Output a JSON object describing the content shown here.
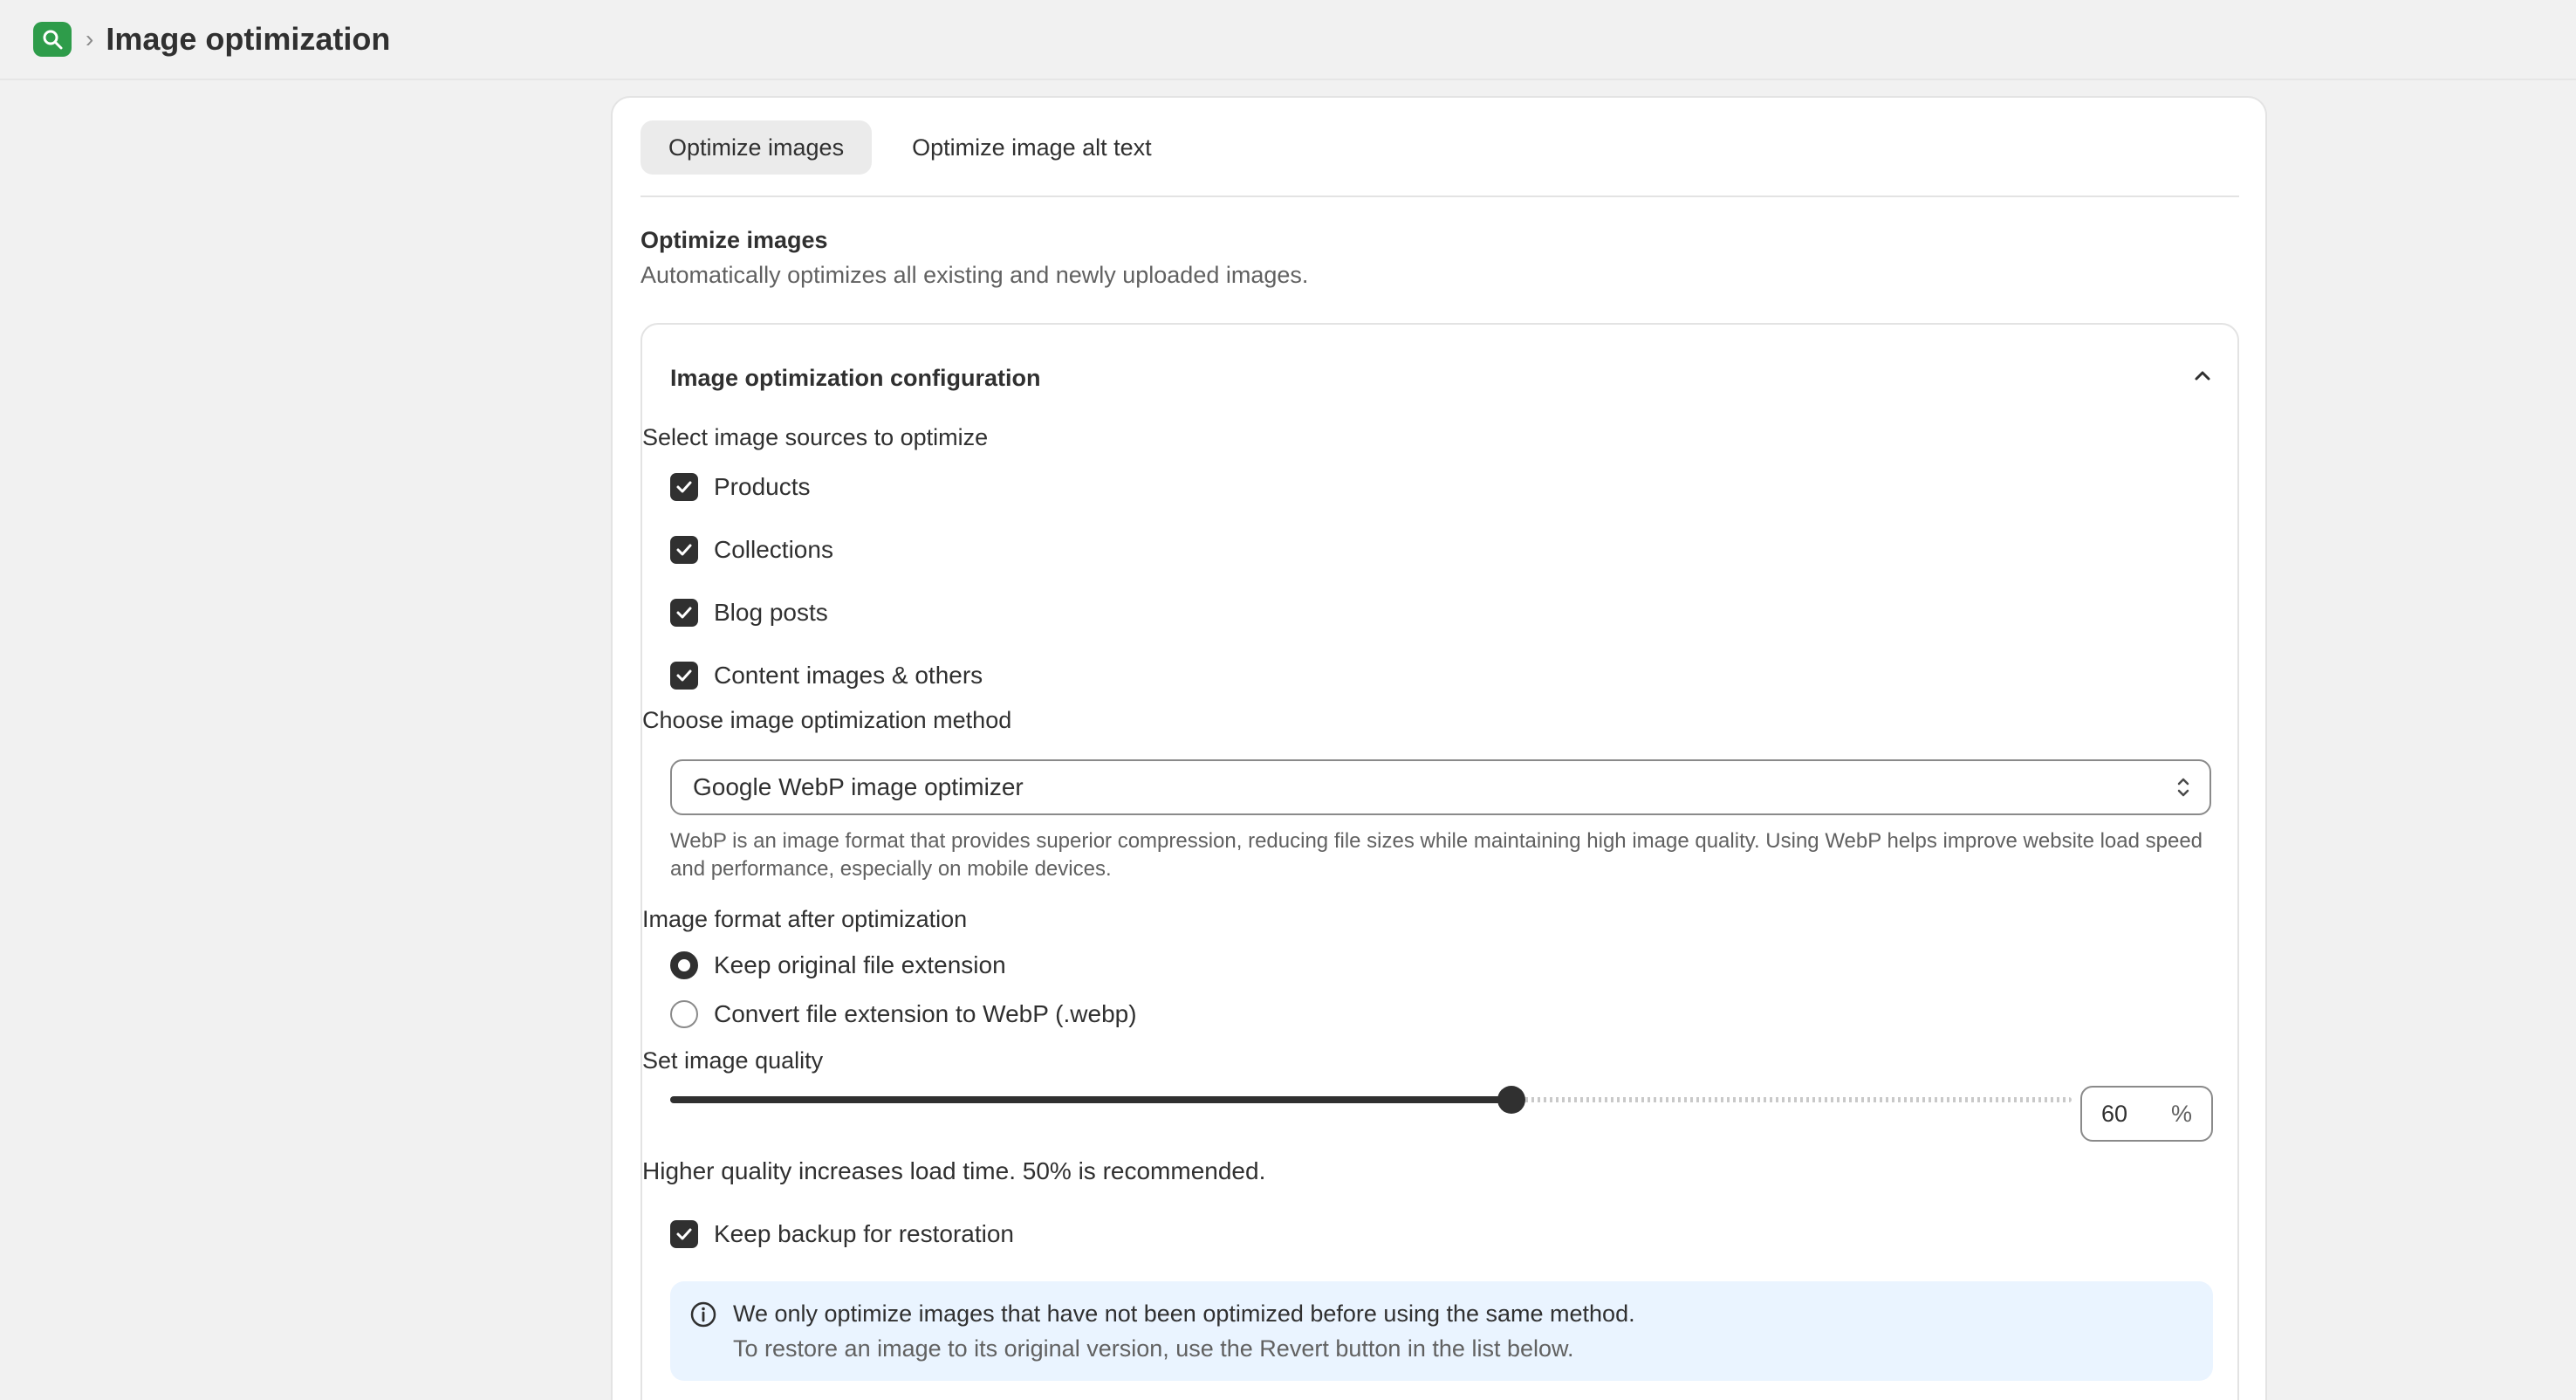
{
  "header": {
    "breadcrumb_separator": "›",
    "title": "Image optimization",
    "app_icon": "search-leaf-icon"
  },
  "tabs": [
    {
      "label": "Optimize images",
      "active": true
    },
    {
      "label": "Optimize image alt text",
      "active": false
    }
  ],
  "section": {
    "title": "Optimize images",
    "description": "Automatically optimizes all existing and newly uploaded images."
  },
  "config": {
    "title": "Image optimization configuration",
    "expanded": true,
    "sources_label": "Select image sources to optimize",
    "sources": [
      {
        "label": "Products",
        "checked": true
      },
      {
        "label": "Collections",
        "checked": true
      },
      {
        "label": "Blog posts",
        "checked": true
      },
      {
        "label": "Content images & others",
        "checked": true
      }
    ],
    "method_label": "Choose image optimization method",
    "method_value": "Google WebP image optimizer",
    "method_help": "WebP is an image format that provides superior compression, reducing file sizes while maintaining high image quality. Using WebP helps improve website load speed and performance, especially on mobile devices.",
    "format_label": "Image format after optimization",
    "format_options": [
      {
        "label": "Keep original file extension",
        "selected": true
      },
      {
        "label": "Convert file extension to WebP (.webp)",
        "selected": false
      }
    ],
    "quality_label": "Set image quality",
    "quality_value": "60",
    "quality_unit": "%",
    "quality_fraction": 0.6,
    "quality_help": "Higher quality increases load time. 50% is recommended.",
    "backup_label": "Keep backup for restoration",
    "backup_checked": true,
    "banner_line1": "We only optimize images that have not been optimized before using the same method.",
    "banner_line2": "To restore an image to its original version, use the Revert button in the list below."
  },
  "colors": {
    "accent": "#303030",
    "app_icon_bg": "#2e9c4a",
    "banner_bg": "#eaf4ff"
  }
}
